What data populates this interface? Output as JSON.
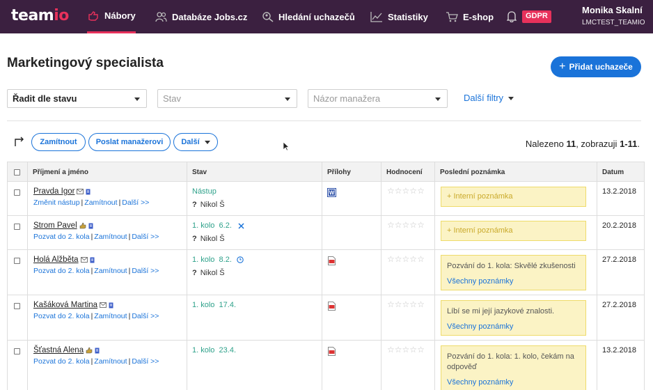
{
  "nav": {
    "logo_main": "team",
    "logo_accent": "io",
    "items": [
      {
        "label": "Nábory",
        "icon": "hand-icon",
        "active": true
      },
      {
        "label": "Databáze Jobs.cz",
        "icon": "people-icon"
      },
      {
        "label": "Hledání uchazečů",
        "icon": "search-people-icon"
      },
      {
        "label": "Statistiky",
        "icon": "chart-icon"
      },
      {
        "label": "E-shop",
        "icon": "cart-icon"
      }
    ],
    "gdpr": "GDPR",
    "user_name": "Monika Skalní",
    "user_id": "LMCTEST_TEAMIO"
  },
  "page": {
    "title": "Marketingový specialista",
    "add_button": "Přidat uchazeče"
  },
  "filters": {
    "sort": "Řadit dle stavu",
    "stav_placeholder": "Stav",
    "manager_placeholder": "Názor manažera",
    "more": "Další filtry"
  },
  "actions": {
    "reject": "Zamítnout",
    "send_manager": "Poslat manažerovi",
    "more": "Další",
    "found_prefix": "Nalezeno ",
    "found_count": "11",
    "found_mid": ", zobrazuji ",
    "found_range": "1-11",
    "found_suffix": "."
  },
  "table": {
    "headers": {
      "name": "Příjmení a jméno",
      "stav": "Stav",
      "prilohy": "Přílohy",
      "hodnoceni": "Hodnocení",
      "poznamka": "Poslední poznámka",
      "datum": "Datum"
    },
    "rows": [
      {
        "name": "Pravda Igor",
        "link1": "Změnit nástup",
        "link2": "Zamítnout",
        "link3": "Další >>",
        "stav": "Nástup",
        "stav_extra": "",
        "who": "Nikol Š",
        "attachment": "word",
        "note": "+ Interní poznámka",
        "note_all": "",
        "date": "13.2.2018",
        "rating": 0
      },
      {
        "name": "Strom Pavel",
        "link1": "Pozvat do 2. kola",
        "link2": "Zamítnout",
        "link3": "Další >>",
        "stav": "1. kolo",
        "stav_date": "6.2.",
        "stav_extra": "x",
        "who": "Nikol Š",
        "attachment": "",
        "note": "+ Interní poznámka",
        "note_all": "",
        "date": "20.2.2018",
        "rating": 0
      },
      {
        "name": "Holá Alžběta",
        "link1": "Pozvat do 2. kola",
        "link2": "Zamítnout",
        "link3": "Další >>",
        "stav": "1. kolo",
        "stav_date": "8.2.",
        "stav_extra": "clock",
        "who": "Nikol Š",
        "attachment": "pdf",
        "note": "Pozvání do 1. kola: Skvělé zkušenosti",
        "note_all": "Všechny poznámky",
        "date": "27.2.2018",
        "rating": 0
      },
      {
        "name": "Kašáková Martina",
        "link1": "Pozvat do 2. kola",
        "link2": "Zamítnout",
        "link3": "Další >>",
        "stav": "1. kolo",
        "stav_date": "17.4.",
        "stav_extra": "",
        "who": "",
        "attachment": "pdf",
        "note": "Líbí se mi její jazykové znalosti.",
        "note_all": "Všechny poznámky",
        "date": "27.2.2018",
        "rating": 0
      },
      {
        "name": "Šťastná Alena",
        "link1": "Pozvat do 2. kola",
        "link2": "Zamítnout",
        "link3": "Další >>",
        "stav": "1. kolo",
        "stav_date": "23.4.",
        "stav_extra": "",
        "who": "",
        "attachment": "pdf",
        "note": "Pozvání do 1. kola: 1. kolo, čekám na odpověď",
        "note_all": "Všechny poznámky",
        "date": "13.2.2018",
        "rating": 0
      }
    ]
  }
}
